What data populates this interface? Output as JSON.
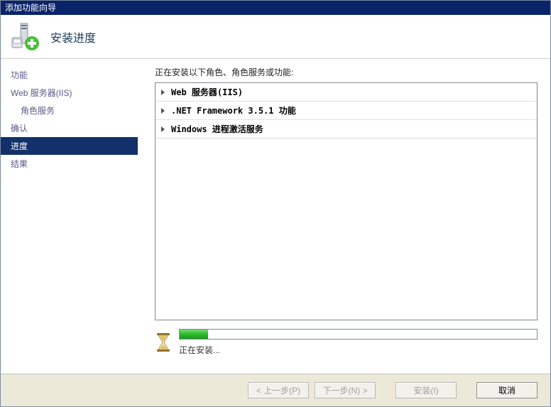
{
  "window": {
    "title": "添加功能向导"
  },
  "header": {
    "title": "安装进度"
  },
  "sidebar": {
    "items": [
      {
        "label": "功能",
        "indent": false,
        "selected": false
      },
      {
        "label": "Web 服务器(IIS)",
        "indent": false,
        "selected": false
      },
      {
        "label": "角色服务",
        "indent": true,
        "selected": false
      },
      {
        "label": "确认",
        "indent": false,
        "selected": false
      },
      {
        "label": "进度",
        "indent": false,
        "selected": true
      },
      {
        "label": "结果",
        "indent": false,
        "selected": false
      }
    ]
  },
  "main": {
    "heading": "正在安装以下角色、角色服务或功能:",
    "items": [
      "Web 服务器(IIS)",
      ".NET Framework 3.5.1 功能",
      "Windows 进程激活服务"
    ],
    "status_text": "正在安装...",
    "progress_percent": 8
  },
  "buttons": {
    "back": "< 上一步(P)",
    "next": "下一步(N) >",
    "install": "安装(I)",
    "cancel": "取消"
  }
}
